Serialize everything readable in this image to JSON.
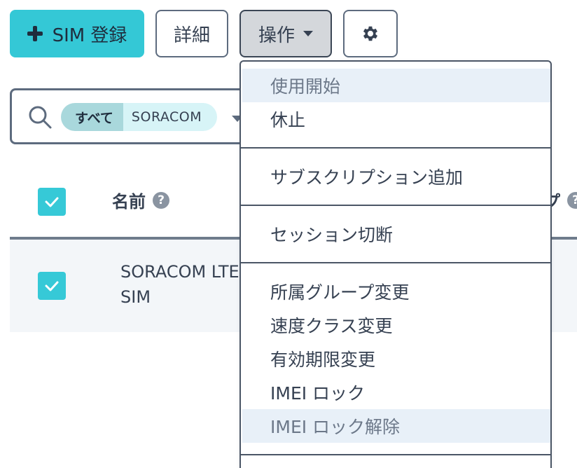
{
  "toolbar": {
    "register_label": "SIM 登録",
    "detail_label": "詳細",
    "operations_label": "操作"
  },
  "search": {
    "filter_key": "すべて",
    "filter_value": "SORACOM"
  },
  "table": {
    "columns": {
      "name": "名前",
      "group_partial": "プ"
    },
    "rows": [
      {
        "name_line1": "SORACOM LTE",
        "name_line2": "SIM"
      }
    ]
  },
  "menu": {
    "items": [
      {
        "label": "使用開始",
        "disabled": true
      },
      {
        "label": "休止",
        "disabled": false
      },
      {
        "label": "サブスクリプション追加",
        "disabled": false
      },
      {
        "label": "セッション切断",
        "disabled": false
      },
      {
        "label": "所属グループ変更",
        "disabled": false
      },
      {
        "label": "速度クラス変更",
        "disabled": false
      },
      {
        "label": "有効期限変更",
        "disabled": false
      },
      {
        "label": "IMEI ロック",
        "disabled": false
      },
      {
        "label": "IMEI ロック解除",
        "disabled": true
      }
    ]
  },
  "colors": {
    "primary": "#34c8d6",
    "checkbox": "#36c9d7",
    "text": "#364152",
    "disabled_bg": "#e8f0f8"
  }
}
